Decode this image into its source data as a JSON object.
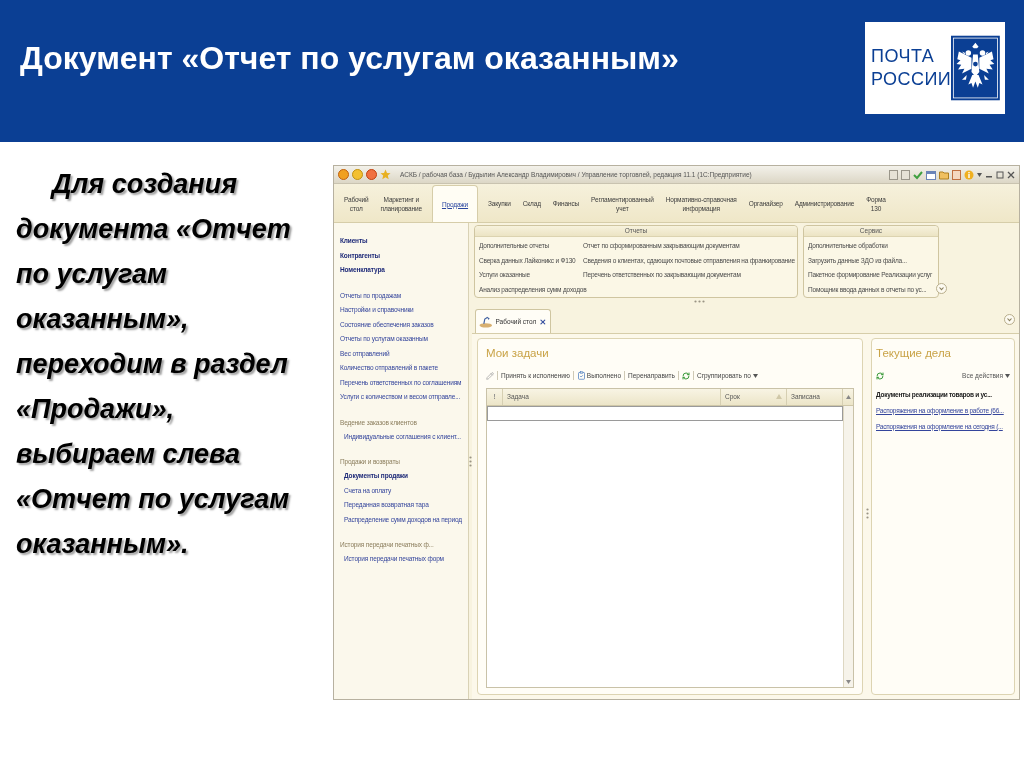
{
  "header": {
    "title": "Документ «Отчет по услугам оказанным»",
    "logo": "ПОЧТА\nРОССИИ"
  },
  "instruction": "Для создания документа «Отчет по услугам оказанным», переходим в раздел «Продажи», выбираем слева «Отчет по услугам оказанным».",
  "app_window": {
    "title": "АСКБ / рабочая база / Будылин Александр Владимирович / Управление торговлей, редакция 11.1 (1С:Предприятие)",
    "sections": [
      {
        "label": "Рабочий\nстол",
        "selected": false
      },
      {
        "label": "Маркетинг и\nпланирование",
        "selected": false
      },
      {
        "label": "Продажи",
        "selected": true
      },
      {
        "label": "Закупки",
        "selected": false
      },
      {
        "label": "Склад",
        "selected": false
      },
      {
        "label": "Финансы",
        "selected": false
      },
      {
        "label": "Регламентированный\nучет",
        "selected": false
      },
      {
        "label": "Нормативно-справочная\nинформация",
        "selected": false
      },
      {
        "label": "Органайзер",
        "selected": false
      },
      {
        "label": "Администрирование",
        "selected": false
      },
      {
        "label": "Форма\n130",
        "selected": false
      }
    ],
    "sidebar": [
      {
        "items": [
          {
            "label": "Клиенты",
            "kind": "bold"
          },
          {
            "label": "Контрагенты",
            "kind": "bold"
          },
          {
            "label": "Номенклатура",
            "kind": "bold"
          }
        ]
      },
      {
        "items": [
          {
            "label": "Отчеты по продажам",
            "kind": "link"
          },
          {
            "label": "Настройки и справочники",
            "kind": "link"
          },
          {
            "label": "Состояние обеспечения заказов",
            "kind": "link"
          },
          {
            "label": "Отчеты по услугам оказанным",
            "kind": "link"
          },
          {
            "label": "Вес отправлений",
            "kind": "link"
          },
          {
            "label": "Количество отправлений в пакете",
            "kind": "link"
          },
          {
            "label": "Перечень ответственных по соглашениям",
            "kind": "link"
          },
          {
            "label": "Услуги с количеством и весом отправле...",
            "kind": "link"
          }
        ]
      },
      {
        "heading": "Ведение заказов клиентов",
        "items": [
          {
            "label": "Индивидуальные соглашения с клиент...",
            "kind": "link"
          }
        ]
      },
      {
        "heading": "Продажи и возвраты",
        "items": [
          {
            "label": "Документы продажи",
            "kind": "bold"
          },
          {
            "label": "Счета на оплату",
            "kind": "link"
          },
          {
            "label": "Переданная возвратная тара",
            "kind": "link"
          },
          {
            "label": "Распределение сумм доходов на период",
            "kind": "link"
          }
        ]
      },
      {
        "heading": "История передачи печатных ф...",
        "items": [
          {
            "label": "История передачи печатных форм",
            "kind": "link"
          }
        ]
      }
    ],
    "action_groups": [
      {
        "title": "Отчеты",
        "columns": [
          [
            "Дополнительные отчеты",
            "Сверка данных Лайконикс и Ф130",
            "Услуги оказанные",
            "Анализ распределения сумм доходов"
          ],
          [
            "Отчет по сформированным закрывающим документам",
            "Сведения о клиентах, сдающих почтовые отправления на франкирование",
            "Перечень ответственных по закрывающим документам"
          ]
        ]
      },
      {
        "title": "Сервис",
        "columns": [
          [
            "Дополнительные обработки",
            "Загрузить данные ЗДО из файла...",
            "Пакетное формирование Реализации услуг",
            "Помощник ввода данных в отчеты по ус..."
          ]
        ]
      }
    ],
    "open_tabs": [
      {
        "label": "Рабочий стол",
        "selected": true
      }
    ],
    "tasks": {
      "title": "Мои задачи",
      "toolbar": [
        "Принять к исполнению",
        "Выполнено",
        "Перенаправить",
        "Сгруппировать по"
      ],
      "columns": [
        {
          "label": "!",
          "sorted": false
        },
        {
          "label": "Задача",
          "sorted": false
        },
        {
          "label": "Срок",
          "sorted": true
        },
        {
          "label": "Записана",
          "sorted": false
        }
      ]
    },
    "current": {
      "title": "Текущие дела",
      "menu": "Все действия",
      "items": [
        {
          "label": "Документы реализации товаров и ус...",
          "kind": "heading"
        },
        {
          "label": "Распоряжения на оформление в работе (66...",
          "kind": "link"
        },
        {
          "label": "Распоряжения на оформление на сегодня (...",
          "kind": "link"
        }
      ]
    }
  }
}
